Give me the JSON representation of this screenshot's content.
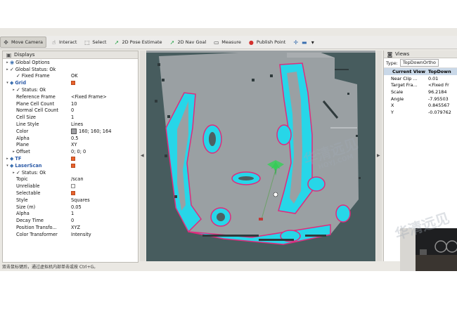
{
  "toolbar": {
    "items": [
      {
        "label": "Move Camera",
        "icon": "move-camera-icon",
        "active": true
      },
      {
        "label": "Interact",
        "icon": "interact-icon",
        "active": false
      },
      {
        "label": "Select",
        "icon": "select-icon",
        "active": false
      },
      {
        "label": "2D Pose Estimate",
        "icon": "pose-estimate-icon",
        "active": false
      },
      {
        "label": "2D Nav Goal",
        "icon": "nav-goal-icon",
        "active": false
      },
      {
        "label": "Measure",
        "icon": "measure-icon",
        "active": false
      },
      {
        "label": "Publish Point",
        "icon": "publish-point-icon",
        "active": false
      }
    ]
  },
  "displays": {
    "title": "Displays",
    "rows": [
      {
        "name": "Global Options",
        "indent": 0,
        "expander": "▸",
        "icon": "globe",
        "value": ""
      },
      {
        "name": "Global Status: Ok",
        "indent": 0,
        "expander": "▸",
        "icon": "tick",
        "value": ""
      },
      {
        "name": "Fixed Frame",
        "indent": 1,
        "expander": "",
        "icon": "tick",
        "value": "OK"
      },
      {
        "name": "Grid",
        "indent": 0,
        "expander": "▾",
        "icon": "plugin",
        "value": "",
        "check": true
      },
      {
        "name": "Status: Ok",
        "indent": 1,
        "expander": "▸",
        "icon": "tick",
        "value": ""
      },
      {
        "name": "Reference Frame",
        "indent": 1,
        "expander": "",
        "icon": "",
        "value": "<Fixed Frame>"
      },
      {
        "name": "Plane Cell Count",
        "indent": 1,
        "expander": "",
        "icon": "",
        "value": "10"
      },
      {
        "name": "Normal Cell Count",
        "indent": 1,
        "expander": "",
        "icon": "",
        "value": "0"
      },
      {
        "name": "Cell Size",
        "indent": 1,
        "expander": "",
        "icon": "",
        "value": "1"
      },
      {
        "name": "Line Style",
        "indent": 1,
        "expander": "",
        "icon": "",
        "value": "Lines"
      },
      {
        "name": "Color",
        "indent": 1,
        "expander": "",
        "icon": "",
        "value": "160; 160; 164",
        "swatch": true
      },
      {
        "name": "Alpha",
        "indent": 1,
        "expander": "",
        "icon": "",
        "value": "0.5"
      },
      {
        "name": "Plane",
        "indent": 1,
        "expander": "",
        "icon": "",
        "value": "XY"
      },
      {
        "name": "Offset",
        "indent": 1,
        "expander": "▸",
        "icon": "",
        "value": "0; 0; 0"
      },
      {
        "name": "TF",
        "indent": 0,
        "expander": "▸",
        "icon": "plugin",
        "value": "",
        "check": true
      },
      {
        "name": "LaserScan",
        "indent": 0,
        "expander": "▾",
        "icon": "plugin",
        "value": "",
        "check": true
      },
      {
        "name": "Status: Ok",
        "indent": 1,
        "expander": "▸",
        "icon": "tick",
        "value": ""
      },
      {
        "name": "Topic",
        "indent": 1,
        "expander": "",
        "icon": "",
        "value": "/scan"
      },
      {
        "name": "Unreliable",
        "indent": 1,
        "expander": "",
        "icon": "",
        "value": "",
        "check": false
      },
      {
        "name": "Selectable",
        "indent": 1,
        "expander": "",
        "icon": "",
        "value": "",
        "check": true
      },
      {
        "name": "Style",
        "indent": 1,
        "expander": "",
        "icon": "",
        "value": "Squares"
      },
      {
        "name": "Size (m)",
        "indent": 1,
        "expander": "",
        "icon": "",
        "value": "0.05"
      },
      {
        "name": "Alpha",
        "indent": 1,
        "expander": "",
        "icon": "",
        "value": "1"
      },
      {
        "name": "Decay Time",
        "indent": 1,
        "expander": "",
        "icon": "",
        "value": "0"
      },
      {
        "name": "Position Transfo...",
        "indent": 1,
        "expander": "",
        "icon": "",
        "value": "XYZ"
      },
      {
        "name": "Color Transformer",
        "indent": 1,
        "expander": "",
        "icon": "",
        "value": "Intensity"
      }
    ]
  },
  "views": {
    "title": "Views",
    "type_label": "Type:",
    "type_value": "TopDownOrtho",
    "headers": [
      "Current View",
      "TopDown"
    ],
    "rows": [
      [
        "Near Clip ...",
        "0.01"
      ],
      [
        "Target Fra...",
        "<Fixed Fr"
      ],
      [
        "Scale",
        "96.2184"
      ],
      [
        "Angle",
        "-7.95503"
      ],
      [
        "X",
        "0.845567"
      ],
      [
        "Y",
        "-0.079762"
      ]
    ]
  },
  "status_bar": {
    "text": "双击鼠标键后，通过虚拟机内部单击或按 Ctrl+G。"
  },
  "watermark": {
    "brand": "华清远见",
    "site": "HQYJ.COM"
  },
  "colors": {
    "map_background": "#475c5e",
    "free_space": "#9aa0a3",
    "inflation": "#27d6e8",
    "obstacle_border": "#e02b7d",
    "accent": "#e8622c"
  }
}
